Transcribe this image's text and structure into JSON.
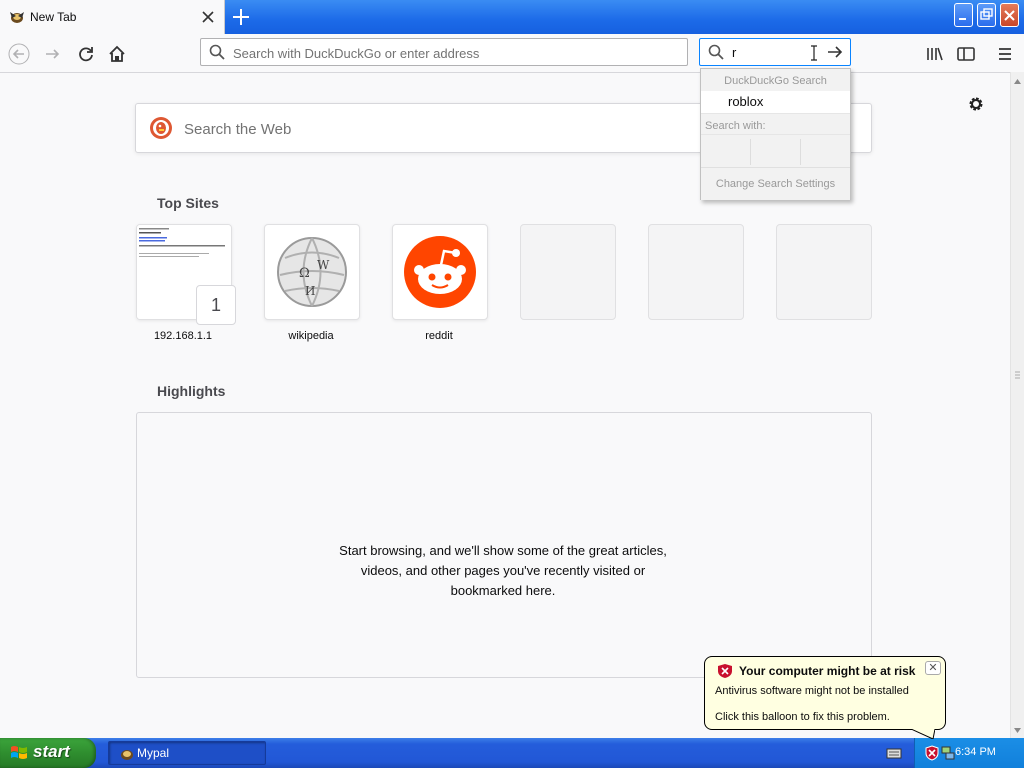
{
  "browser": {
    "tab": {
      "title": "New Tab"
    },
    "urlbar": {
      "placeholder": "Search with DuckDuckGo or enter address",
      "value": ""
    },
    "searchbar": {
      "value": "r"
    }
  },
  "search_dropdown": {
    "header": "DuckDuckGo Search",
    "suggestion": "roblox",
    "search_with_label": "Search with:",
    "settings_label": "Change Search Settings"
  },
  "newtab": {
    "search_placeholder": "Search the Web",
    "top_sites_title": "Top Sites",
    "top_sites": [
      {
        "label": "192.168.1.1",
        "badge": "1"
      },
      {
        "label": "wikipedia"
      },
      {
        "label": "reddit"
      },
      {
        "label": ""
      },
      {
        "label": ""
      },
      {
        "label": ""
      }
    ],
    "highlights_title": "Highlights",
    "highlights_message": "Start browsing, and we'll show some of the great articles, videos, and other pages you've recently visited or bookmarked here."
  },
  "taskbar": {
    "start_label": "start",
    "task_label": "Mypal",
    "clock": "6:34 PM"
  },
  "balloon": {
    "title": "Your computer might be at risk",
    "line1": "Antivirus software might not be installed",
    "line2": "Click this balloon to fix this problem."
  },
  "colors": {
    "accent": "#0a84ff",
    "reddit": "#ff4500",
    "ddg": "#de5833",
    "xp_taskbar": "#245ddb",
    "xp_start": "#2f8e2f",
    "balloon_bg": "#ffffe1"
  }
}
